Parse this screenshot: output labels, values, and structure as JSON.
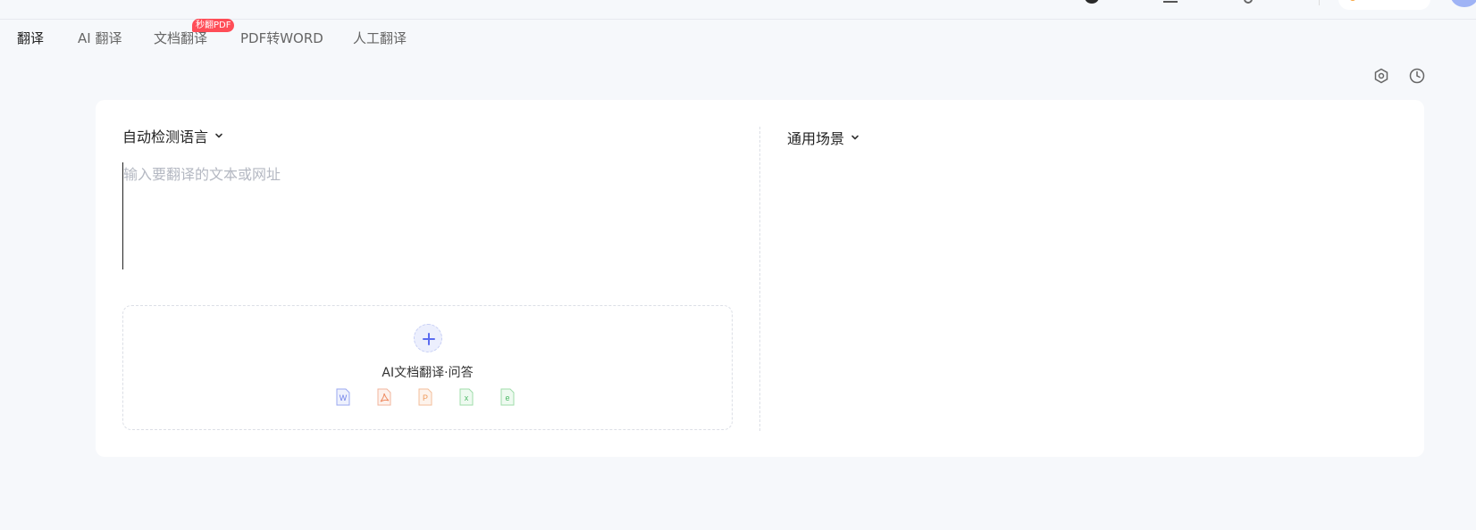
{
  "tabs": [
    {
      "label": "翻译",
      "active": true
    },
    {
      "label": "AI 翻译"
    },
    {
      "label": "文档翻译"
    },
    {
      "label": "PDF转WORD"
    },
    {
      "label": "人工翻译"
    }
  ],
  "badge": "秒翻PDF",
  "tools": {
    "settings_icon": "settings-hexagon-icon",
    "history_icon": "clock-icon"
  },
  "source": {
    "language": "自动检测语言",
    "placeholder": "输入要翻译的文本或网址"
  },
  "target": {
    "scene": "通用场景"
  },
  "upload": {
    "label": "AI文档翻译·问答",
    "file_types": [
      "word-file-icon",
      "pdf-file-icon",
      "ppt-file-icon",
      "excel-file-icon",
      "epub-file-icon"
    ]
  },
  "colors": {
    "accent": "#5b6cf0",
    "badge": "#ff4d57",
    "background": "#f6f8fb"
  }
}
